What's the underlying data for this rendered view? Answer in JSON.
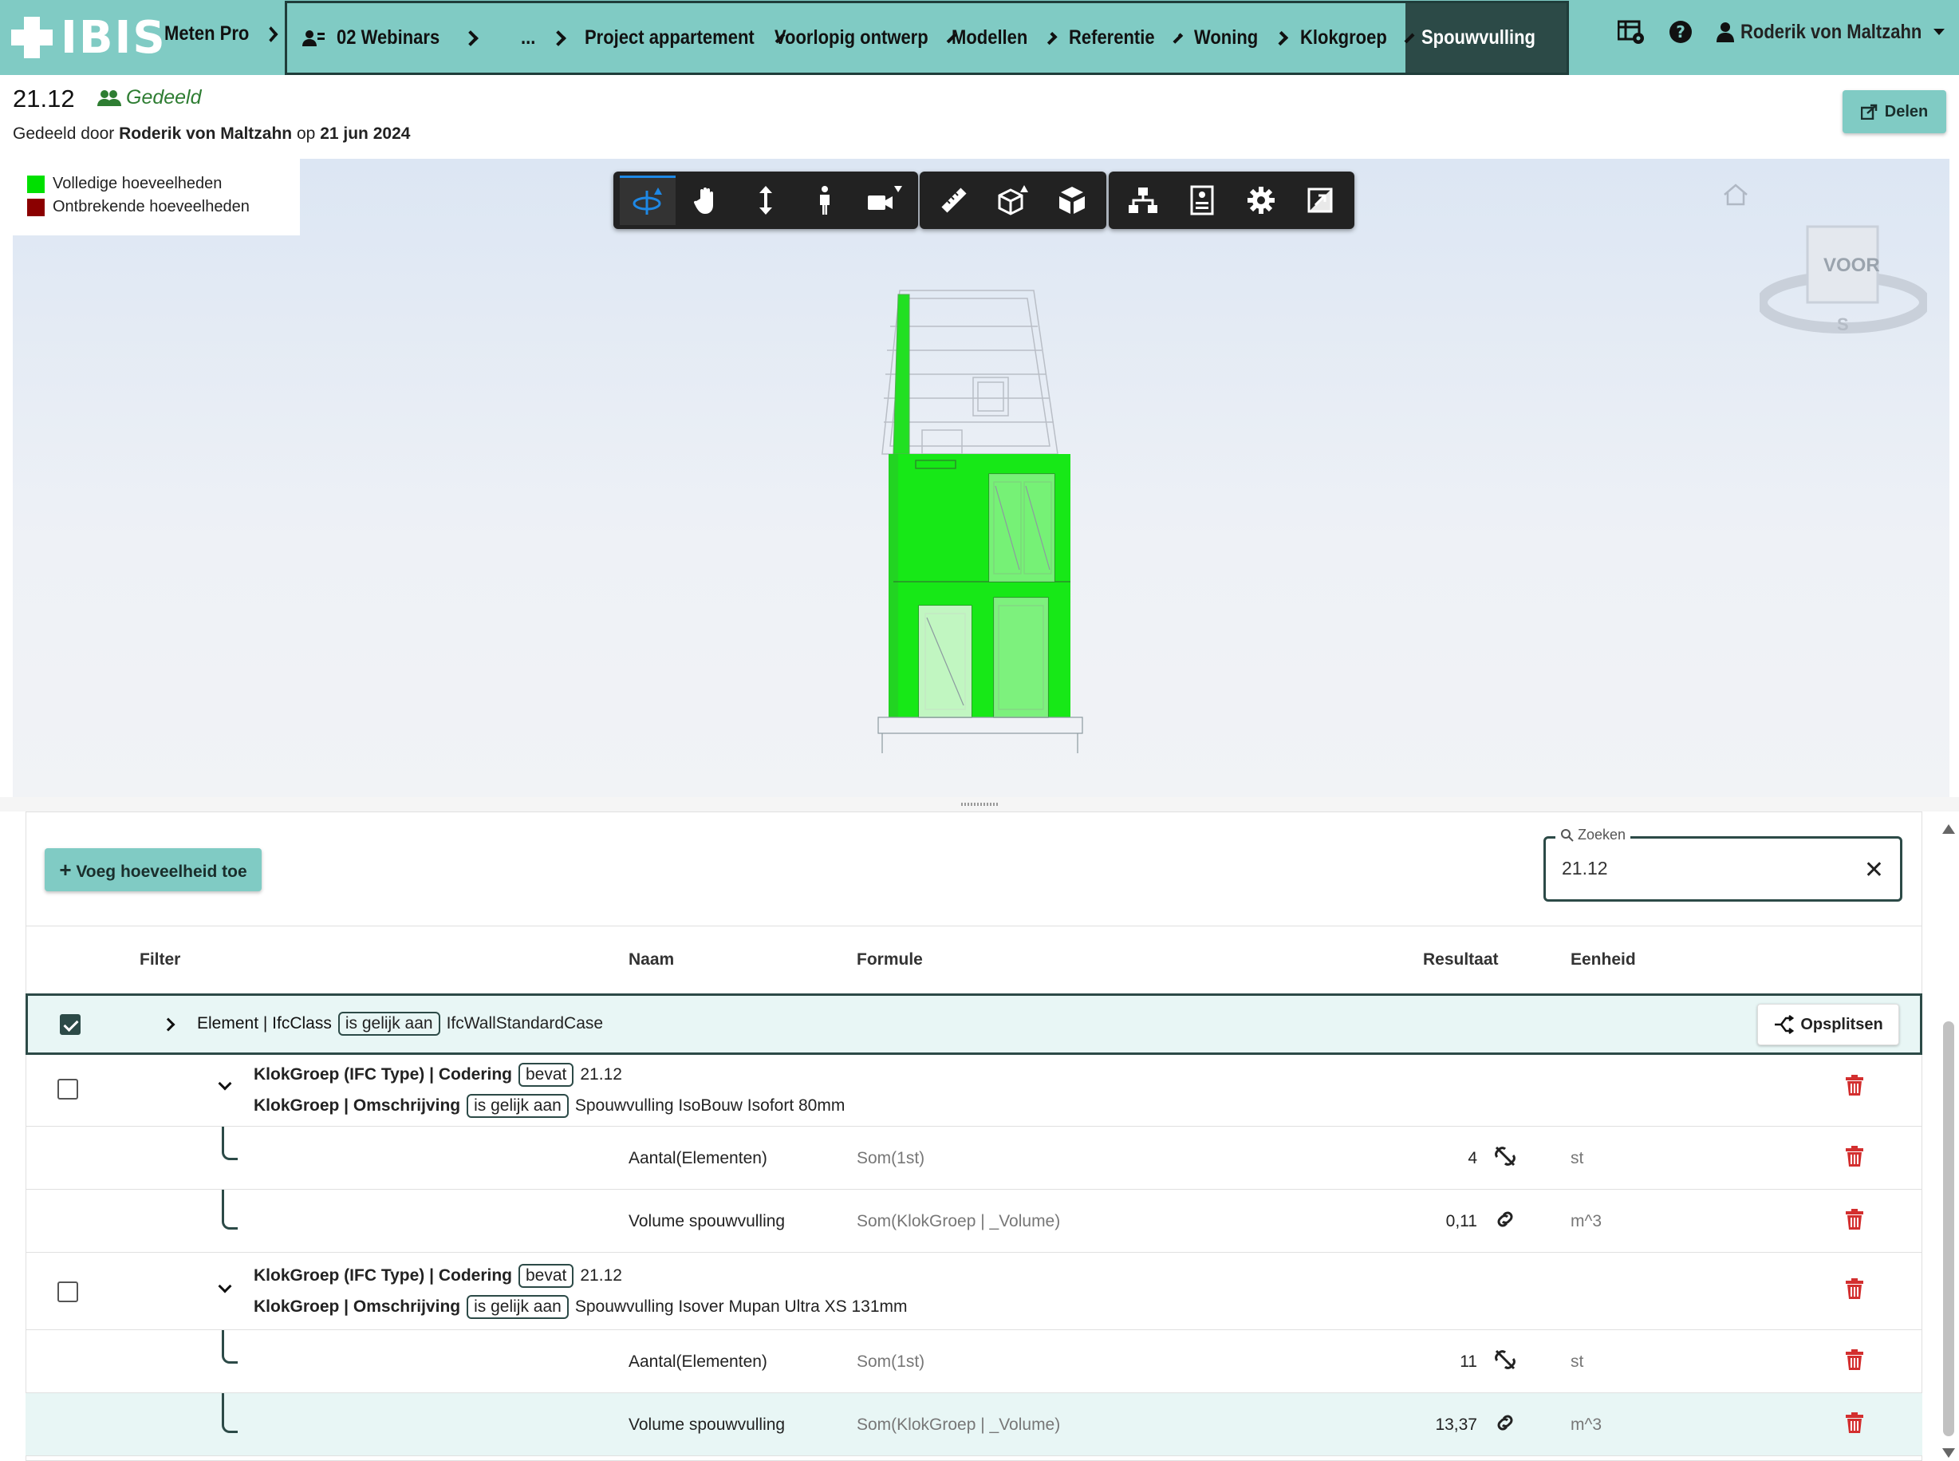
{
  "app": {
    "logo": "IBIS",
    "name": "Meten Pro"
  },
  "breadcrumb": [
    {
      "label": "02 Webinars",
      "icon": "user-group-icon"
    },
    {
      "label": "..."
    },
    {
      "label": "Project appartement"
    },
    {
      "label": "Voorlopig ontwerp"
    },
    {
      "label": "Modellen"
    },
    {
      "label": "Referentie"
    },
    {
      "label": "Woning"
    },
    {
      "label": "Klokgroep"
    }
  ],
  "breadcrumb_active": "Spouwvulling",
  "user": {
    "name": "Roderik von Maltzahn"
  },
  "header": {
    "code": "21.12",
    "shared_label": "Gedeeld",
    "shared_by_prefix": "Gedeeld door",
    "shared_by_name": "Roderik von Maltzahn",
    "shared_on": "op",
    "shared_date": "21 jun 2024",
    "share_button": "Delen"
  },
  "legend": [
    {
      "label": "Volledige hoeveelheden",
      "color": "#00e000"
    },
    {
      "label": "Ontbrekende hoeveelheden",
      "color": "#8b0000"
    }
  ],
  "viewcube": {
    "face": "VOOR",
    "south": "S"
  },
  "toolbar": {
    "navigation": [
      "orbit-icon",
      "pan-icon",
      "zoom-icon",
      "walk-icon",
      "camera-icon"
    ],
    "model": [
      "measure-icon",
      "section-icon",
      "explode-icon"
    ],
    "settings": [
      "model-tree-icon",
      "properties-icon",
      "settings-icon",
      "fullscreen-icon"
    ]
  },
  "panel": {
    "add_button": "Voeg hoeveelheid toe",
    "search_label": "Zoeken",
    "search_value": "21.12",
    "columns": {
      "filter": "Filter",
      "name": "Naam",
      "formula": "Formule",
      "result": "Resultaat",
      "unit": "Eenheid"
    }
  },
  "group_row": {
    "field": "Element | IfcClass",
    "operator": "is gelijk aan",
    "value": "IfcWallStandardCase",
    "split_button": "Opsplitsen"
  },
  "subgroups": [
    {
      "cond1_field": "KlokGroep (IFC Type) | Codering",
      "cond1_op": "bevat",
      "cond1_value": "21.12",
      "cond2_field": "KlokGroep | Omschrijving",
      "cond2_op": "is gelijk aan",
      "cond2_value": "Spouwvulling IsoBouw Isofort 80mm",
      "rows": [
        {
          "name": "Aantal(Elementen)",
          "formula": "Som(1st)",
          "result": "4",
          "link": "unlink-icon",
          "unit": "st"
        },
        {
          "name": "Volume spouwvulling",
          "formula": "Som(KlokGroep | _Volume)",
          "result": "0,11",
          "link": "link-icon",
          "unit": "m^3"
        }
      ]
    },
    {
      "cond1_field": "KlokGroep (IFC Type) | Codering",
      "cond1_op": "bevat",
      "cond1_value": "21.12",
      "cond2_field": "KlokGroep | Omschrijving",
      "cond2_op": "is gelijk aan",
      "cond2_value": "Spouwvulling Isover Mupan Ultra XS 131mm",
      "rows": [
        {
          "name": "Aantal(Elementen)",
          "formula": "Som(1st)",
          "result": "11",
          "link": "unlink-icon",
          "unit": "st"
        },
        {
          "name": "Volume spouwvulling",
          "formula": "Som(KlokGroep | _Volume)",
          "result": "13,37",
          "link": "link-icon",
          "unit": "m^3"
        }
      ]
    }
  ],
  "colors": {
    "brand": "#80cbc4",
    "dark": "#2c4a47",
    "delete": "#d32f2f",
    "complete": "#00e000"
  }
}
